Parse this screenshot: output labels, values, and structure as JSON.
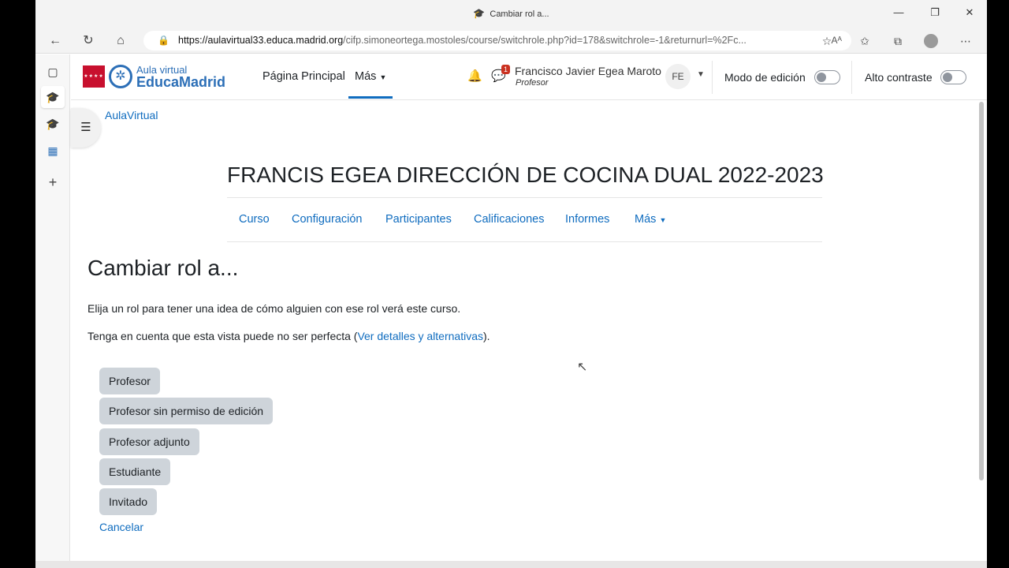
{
  "browser": {
    "tab_title": "Cambiar rol a...",
    "url_host": "https://aulavirtual33.educa.madrid.org",
    "url_path": "/cifp.simoneortega.mostoles/course/switchrole.php?id=178&switchrole=-1&returnurl=%2Fc...",
    "reader_icon": "Aᴬ"
  },
  "site": {
    "logo_top": "Aula virtual",
    "logo_bottom": "EducaMadrid",
    "nav_home": "Página Principal",
    "nav_more": "Más",
    "notification_badge": "1",
    "user_name": "Francisco Javier Egea Maroto",
    "user_role": "Profesor",
    "user_initials": "FE",
    "edit_mode_label": "Modo de edición",
    "contrast_label": "Alto contraste",
    "breadcrumb": "AulaVirtual"
  },
  "course": {
    "title": "FRANCIS EGEA DIRECCIÓN DE COCINA DUAL 2022-2023",
    "tabs": [
      "Curso",
      "Configuración",
      "Participantes",
      "Calificaciones",
      "Informes",
      "Más"
    ]
  },
  "main": {
    "heading": "Cambiar rol a...",
    "intro": "Elija un rol para tener una idea de cómo alguien con ese rol verá este curso.",
    "note_before": "Tenga en cuenta que esta vista puede no ser perfecta (",
    "note_link": "Ver detalles y alternativas",
    "note_after": ").",
    "roles": [
      "Profesor",
      "Profesor sin permiso de edición",
      "Profesor adjunto",
      "Estudiante",
      "Invitado"
    ],
    "cancel": "Cancelar"
  },
  "colors": {
    "link": "#0f6cbf",
    "brand_blue": "#2c6fb7",
    "madrid_red": "#c8102e",
    "button_gray": "#ced4da"
  }
}
